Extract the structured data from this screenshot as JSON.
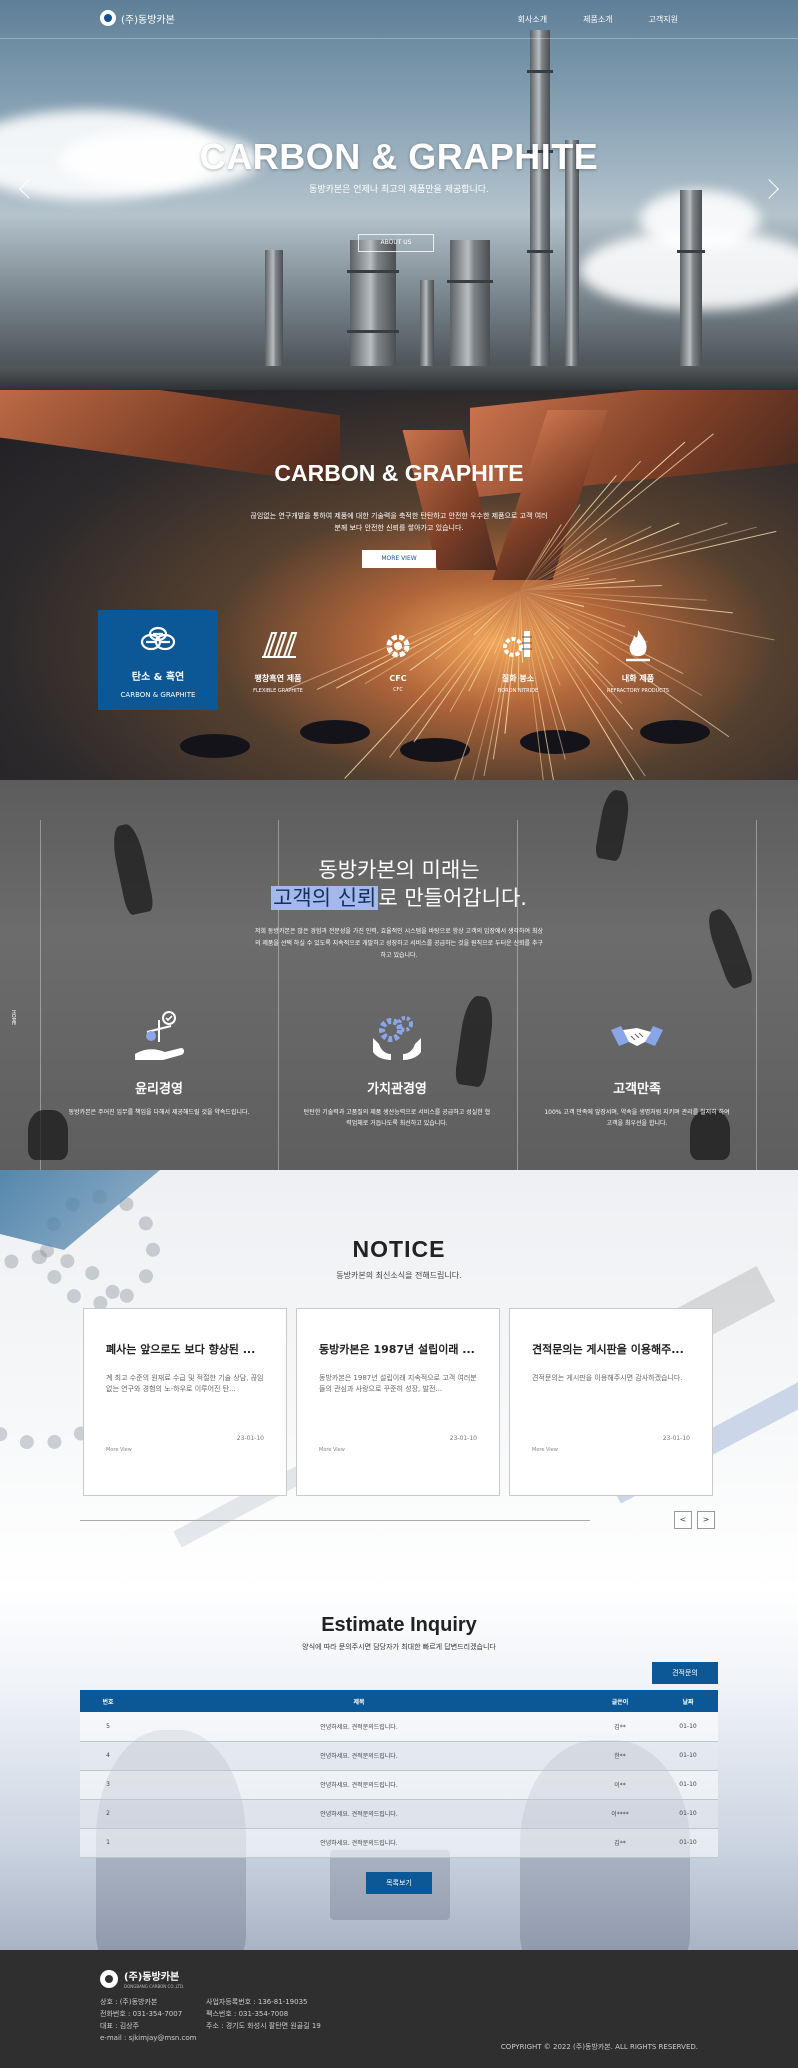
{
  "header": {
    "logo_text": "(주)동방카본",
    "nav": [
      "회사소개",
      "제품소개",
      "고객지원"
    ]
  },
  "hero": {
    "title": "CARBON & GRAPHITE",
    "subtitle": "동방카본은 언제나 최고의 제품만을 제공합니다.",
    "button": "ABOUT US"
  },
  "products": {
    "title": "CARBON & GRAPHITE",
    "description": "끊임없는 연구개발을 통하여 제품에 대한 기술력을 축적한 탄탄하고 안전한 우수한 제품으로 고객 여러분께 보다 안전한 신뢰를 쌓아가고 있습니다.",
    "button": "MORE VIEW",
    "items": [
      {
        "name": "탄소 & 흑연",
        "en": "CARBON & GRAPHITE",
        "icon": "carbon-icon"
      },
      {
        "name": "팽창흑연 제품",
        "en": "FLEXIBLE GRAPHITE",
        "icon": "flexible-graphite-icon"
      },
      {
        "name": "CFC",
        "en": "CFC",
        "icon": "cfc-gear-icon"
      },
      {
        "name": "질화 붕소",
        "en": "BORON NITRIDE",
        "icon": "boron-nitride-icon"
      },
      {
        "name": "내화 제품",
        "en": "REFRACTORY PRODUCTS",
        "icon": "flame-icon"
      }
    ]
  },
  "values": {
    "heading_line1": "동방카본의 미래는",
    "heading_highlight": "고객의 신뢰",
    "heading_rest": "로 만들어갑니다.",
    "description": "저희 동방카본은 많은 경험과 전문성을 가진 인력, 효율적인 시스템을 바탕으로 항상 고객의 입장에서 생각하여 최상의 제품을 선택 하실 수 있도록 지속적으로 개발하고 성장하고 서비스를 공급하는 것을 원칙으로 두터운 신뢰를 추구하고 있습니다.",
    "side_label": "HOME",
    "items": [
      {
        "name": "윤리경영",
        "text": "동방카본은 주어진 임무를 책임을 다해서 제공해드릴 것을 약속드립니다.",
        "icon": "ethics-hand-icon"
      },
      {
        "name": "가치관경영",
        "text": "탄탄한 기술력과 고품질의 제품 생산능력으로 서비스를 공급하고 성실한 협력업체로 거듭나도록 최선하고 있습니다.",
        "icon": "gears-hands-icon"
      },
      {
        "name": "고객만족",
        "text": "100% 고객 만족에 앞장서며, 약속을 생명처럼 지키며 관리를 철저히 하여 고객을 최우선을 합니다.",
        "icon": "handshake-icon"
      }
    ]
  },
  "notice": {
    "title": "NOTICE",
    "subtitle": "동방카본의 최신소식을 전해드립니다.",
    "more": "More View",
    "cards": [
      {
        "title": "폐사는 앞으로도 보다 향상된 ...",
        "text": "계 최고 수준의 원재료 수급 및 적절한 기술 상담, 끊임없는 연구와 경험의 노-하우로 이루어진 탄...",
        "date": "23-01-10"
      },
      {
        "title": "동방카본은 1987년 설립이래 ...",
        "text": "동방카본은 1987년 설립이래 지속적으로 고객 여러분들의 관심과 사랑으로 꾸준히 성장, 발전...",
        "date": "23-01-10"
      },
      {
        "title": "견적문의는 게시판을 이용해주...",
        "text": "견적문의는 게시판을 이용해주시면 감사하겠습니다.",
        "date": "23-01-10"
      }
    ],
    "prev": "<",
    "next": ">"
  },
  "estimate": {
    "title": "Estimate Inquiry",
    "subtitle": "양식에 따라 문의주시면 담당자가 최대한 빠르게 답변드리겠습니다",
    "write_button": "견적문의",
    "list_button": "목록보기",
    "columns": [
      "번호",
      "제목",
      "글쓴이",
      "날짜"
    ],
    "rows": [
      {
        "no": "5",
        "title": "안녕하세요. 견적문의드립니다.",
        "writer": "김**",
        "date": "01-10"
      },
      {
        "no": "4",
        "title": "안녕하세요. 견적문의드립니다.",
        "writer": "한**",
        "date": "01-10"
      },
      {
        "no": "3",
        "title": "안녕하세요. 견적문의드립니다.",
        "writer": "이**",
        "date": "01-10"
      },
      {
        "no": "2",
        "title": "안녕하세요. 견적문의드립니다.",
        "writer": "이****",
        "date": "01-10"
      },
      {
        "no": "1",
        "title": "안녕하세요. 견적문의드립니다.",
        "writer": "김**",
        "date": "01-10"
      }
    ]
  },
  "footer": {
    "name": "(주)동방카본",
    "name_en": "DONGBANG CARBON CO.,LTD.",
    "col1": [
      "상호 : (주)동방카본",
      "전화번호 : 031-354-7007",
      "대표 : 김상주",
      "e-mail : sjkimjay@msn.com"
    ],
    "col2": [
      "사업자등록번호 : 136-81-19035",
      "팩스번호 : 031-354-7008",
      "주소 : 경기도 화성시 팔탄면 원골길 19"
    ],
    "copyright": "COPYRIGHT © 2022 (주)동방카본. ALL RIGHTS RESERVED."
  },
  "colors": {
    "brand_blue": "#0c5795",
    "highlight": "#a4b9ea",
    "footer_bg": "#2f2f30"
  }
}
